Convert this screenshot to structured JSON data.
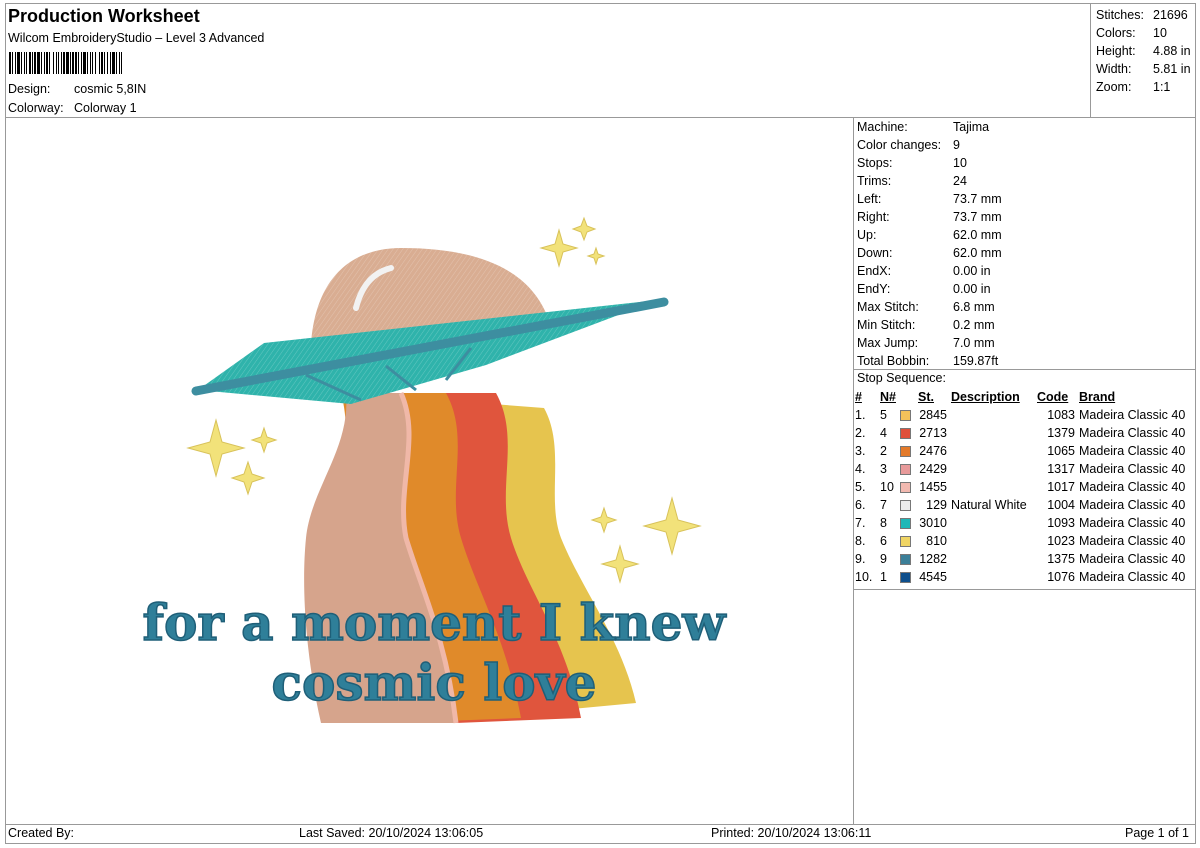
{
  "header": {
    "title": "Production Worksheet",
    "subtitle": "Wilcom EmbroideryStudio – Level 3 Advanced",
    "design_label": "Design:",
    "design_value": "cosmic 5,8IN",
    "colorway_label": "Colorway:",
    "colorway_value": "Colorway 1"
  },
  "stats": [
    {
      "label": "Stitches:",
      "value": "21696"
    },
    {
      "label": "Colors:",
      "value": "10"
    },
    {
      "label": "Height:",
      "value": "4.88 in"
    },
    {
      "label": "Width:",
      "value": "5.81 in"
    },
    {
      "label": "Zoom:",
      "value": "1:1"
    }
  ],
  "machine_info": [
    {
      "label": "Machine:",
      "value": "Tajima"
    },
    {
      "label": "Color changes:",
      "value": "9"
    },
    {
      "label": "Stops:",
      "value": "10"
    },
    {
      "label": "Trims:",
      "value": "24"
    },
    {
      "label": "Left:",
      "value": "73.7 mm"
    },
    {
      "label": "Right:",
      "value": "73.7 mm"
    },
    {
      "label": "Up:",
      "value": "62.0 mm"
    },
    {
      "label": "Down:",
      "value": "62.0 mm"
    },
    {
      "label": "EndX:",
      "value": "0.00 in"
    },
    {
      "label": "EndY:",
      "value": "0.00 in"
    },
    {
      "label": "Max Stitch:",
      "value": "6.8 mm"
    },
    {
      "label": "Min Stitch:",
      "value": "0.2 mm"
    },
    {
      "label": "Max Jump:",
      "value": "7.0 mm"
    },
    {
      "label": "Total Bobbin:",
      "value": "159.87ft"
    }
  ],
  "stop_sequence": {
    "title": "Stop Sequence:",
    "headers": {
      "idx": "#",
      "n": "N#",
      "st": "St.",
      "desc": "Description",
      "code": "Code",
      "brand": "Brand"
    },
    "rows": [
      {
        "idx": "1.",
        "n": "5",
        "color": "#f3c25a",
        "st": "2845",
        "desc": "",
        "code": "1083",
        "brand": "Madeira Classic 40"
      },
      {
        "idx": "2.",
        "n": "4",
        "color": "#e0503a",
        "st": "2713",
        "desc": "",
        "code": "1379",
        "brand": "Madeira Classic 40"
      },
      {
        "idx": "3.",
        "n": "2",
        "color": "#e37a2a",
        "st": "2476",
        "desc": "",
        "code": "1065",
        "brand": "Madeira Classic 40"
      },
      {
        "idx": "4.",
        "n": "3",
        "color": "#e89a9a",
        "st": "2429",
        "desc": "",
        "code": "1317",
        "brand": "Madeira Classic 40"
      },
      {
        "idx": "5.",
        "n": "10",
        "color": "#f2b9b0",
        "st": "1455",
        "desc": "",
        "code": "1017",
        "brand": "Madeira Classic 40"
      },
      {
        "idx": "6.",
        "n": "7",
        "color": "#ececec",
        "st": "129",
        "desc": "Natural White",
        "code": "1004",
        "brand": "Madeira Classic 40"
      },
      {
        "idx": "7.",
        "n": "8",
        "color": "#1fb8b8",
        "st": "3010",
        "desc": "",
        "code": "1093",
        "brand": "Madeira Classic 40"
      },
      {
        "idx": "8.",
        "n": "6",
        "color": "#f0d564",
        "st": "810",
        "desc": "",
        "code": "1023",
        "brand": "Madeira Classic 40"
      },
      {
        "idx": "9.",
        "n": "9",
        "color": "#3b7f98",
        "st": "1282",
        "desc": "",
        "code": "1375",
        "brand": "Madeira Classic 40"
      },
      {
        "idx": "10.",
        "n": "1",
        "color": "#0e4f8c",
        "st": "4545",
        "desc": "",
        "code": "1076",
        "brand": "Madeira Classic 40"
      }
    ]
  },
  "design_text": {
    "line1": "for a moment I knew",
    "line2": "cosmic love"
  },
  "footer": {
    "created_by": "Created By:",
    "last_saved": "Last Saved: 20/10/2024 13:06:05",
    "printed": "Printed: 20/10/2024 13:06:11",
    "page": "Page 1 of 1"
  }
}
